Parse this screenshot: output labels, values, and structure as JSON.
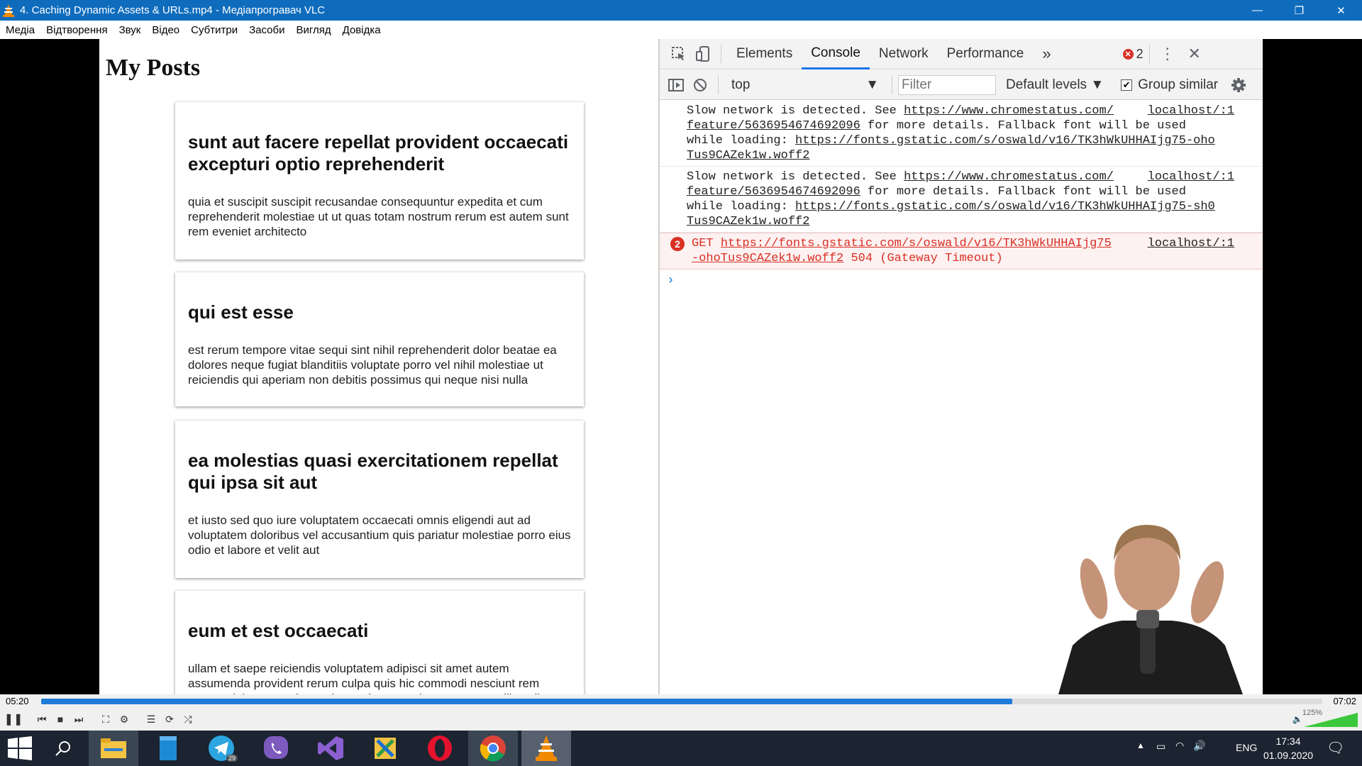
{
  "window": {
    "title": "4. Caching Dynamic Assets & URLs.mp4 - Медіапрогравач VLC",
    "minimize": "—",
    "restore": "❐",
    "close": "✕"
  },
  "menu": [
    "Медіа",
    "Відтворення",
    "Звук",
    "Відео",
    "Субтитри",
    "Засоби",
    "Вигляд",
    "Довідка"
  ],
  "page": {
    "heading": "My Posts",
    "posts": [
      {
        "title": "sunt aut facere repellat provident occaecati excepturi optio reprehenderit",
        "body": "quia et suscipit suscipit recusandae consequuntur expedita et cum reprehenderit molestiae ut ut quas totam nostrum rerum est autem sunt rem eveniet architecto"
      },
      {
        "title": "qui est esse",
        "body": "est rerum tempore vitae sequi sint nihil reprehenderit dolor beatae ea dolores neque fugiat blanditiis voluptate porro vel nihil molestiae ut reiciendis qui aperiam non debitis possimus qui neque nisi nulla"
      },
      {
        "title": "ea molestias quasi exercitationem repellat qui ipsa sit aut",
        "body": "et iusto sed quo iure voluptatem occaecati omnis eligendi aut ad voluptatem doloribus vel accusantium quis pariatur molestiae porro eius odio et labore et velit aut"
      },
      {
        "title": "eum et est occaecati",
        "body": "ullam et saepe reiciendis voluptatem adipisci sit amet autem assumenda provident rerum culpa quis hic commodi nesciunt rem tenetur doloremque ipsam iure quis sunt voluptatem rerum illo velit"
      }
    ]
  },
  "devtools": {
    "tabs": [
      "Elements",
      "Console",
      "Network",
      "Performance"
    ],
    "active_tab": "Console",
    "more_tabs": "»",
    "error_count": "2",
    "context": "top",
    "filter_placeholder": "Filter",
    "levels": "Default levels ▼",
    "group_similar": "Group similar",
    "messages": [
      {
        "type": "warning",
        "lines": [
          {
            "pre": "Slow network is detected. See ",
            "link": "https://www.chromestatus.com/"
          },
          {
            "link": "feature/5636954674692096",
            "post": " for more details. Fallback font will be used"
          },
          {
            "pre": "while loading: ",
            "link": "https://fonts.gstatic.com/s/oswald/v16/TK3hWkUHHAIjg75-oho"
          },
          {
            "link": "Tus9CAZek1w.woff2"
          }
        ],
        "source": "localhost/:1"
      },
      {
        "type": "warning",
        "lines": [
          {
            "pre": "Slow network is detected. See ",
            "link": "https://www.chromestatus.com/"
          },
          {
            "link": "feature/5636954674692096",
            "post": " for more details. Fallback font will be used"
          },
          {
            "pre": "while loading: ",
            "link": "https://fonts.gstatic.com/s/oswald/v16/TK3hWkUHHAIjg75-sh0"
          },
          {
            "link": "Tus9CAZek1w.woff2"
          }
        ],
        "source": "localhost/:1"
      },
      {
        "type": "error",
        "badge": "2",
        "lines": [
          {
            "pre": "GET ",
            "link": "https://fonts.gstatic.com/s/oswald/v16/TK3hWkUHHAIjg75"
          },
          {
            "link": "-ohoTus9CAZek1w.woff2",
            "post": " 504 (Gateway Timeout)"
          }
        ],
        "source": "localhost/:1"
      }
    ],
    "prompt": "›"
  },
  "player": {
    "elapsed": "05:20",
    "total": "07:02",
    "progress": 0.758,
    "volume_label": "125%",
    "volume_level": 1.25
  },
  "taskbar": {
    "items": [
      "windows-start-icon",
      "search-icon",
      "file-explorer-icon",
      "notepad-icon",
      "telegram-icon",
      "viber-icon",
      "visual-studio-icon",
      "tool-icon",
      "opera-icon",
      "chrome-icon",
      "vlc-icon"
    ],
    "telegram_badge": "29",
    "language": "ENG",
    "time": "17:34",
    "date": "01.09.2020"
  },
  "colors": {
    "titlebar": "#0f6cbd",
    "accent": "#1e7bd8",
    "error": "#d93025",
    "taskbar": "#1b2430"
  }
}
